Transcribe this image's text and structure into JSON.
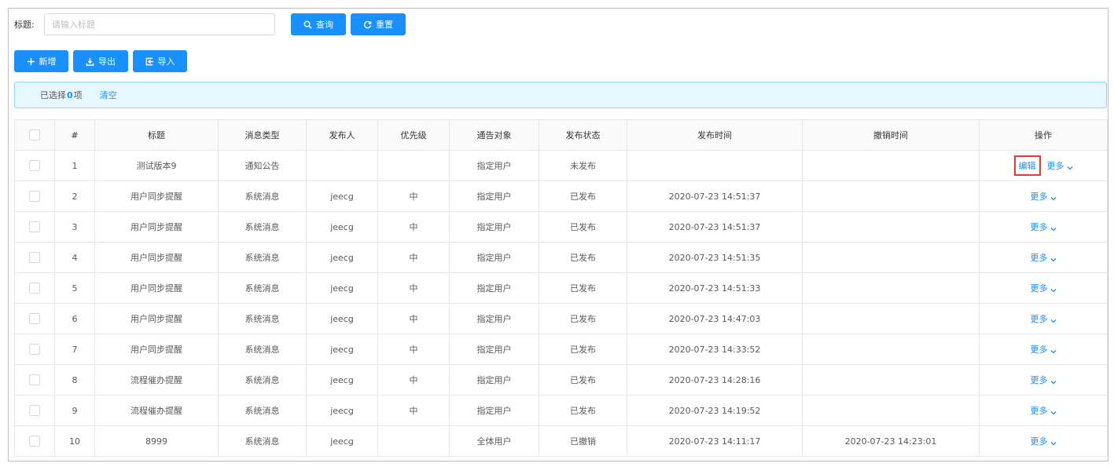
{
  "search": {
    "label": "标题:",
    "placeholder": "请输入标题",
    "query_label": "查询",
    "reset_label": "重置"
  },
  "toolbar": {
    "add_label": "新增",
    "export_label": "导出",
    "import_label": "导入"
  },
  "alert": {
    "prefix": "已选择",
    "count": "0",
    "suffix": "项",
    "clear_label": "清空"
  },
  "table": {
    "columns": [
      "#",
      "标题",
      "消息类型",
      "发布人",
      "优先级",
      "通告对象",
      "发布状态",
      "发布时间",
      "撤销时间",
      "操作"
    ],
    "edit_label": "编辑",
    "more_label": "更多",
    "rows": [
      {
        "index": "1",
        "title": "测试版本9",
        "type": "通知公告",
        "publisher": "",
        "priority": "",
        "target": "指定用户",
        "status": "未发布",
        "publish_time": "",
        "revoke_time": "",
        "has_edit": true
      },
      {
        "index": "2",
        "title": "用户同步提醒",
        "type": "系统消息",
        "publisher": "jeecg",
        "priority": "中",
        "target": "指定用户",
        "status": "已发布",
        "publish_time": "2020-07-23 14:51:37",
        "revoke_time": "",
        "has_edit": false
      },
      {
        "index": "3",
        "title": "用户同步提醒",
        "type": "系统消息",
        "publisher": "jeecg",
        "priority": "中",
        "target": "指定用户",
        "status": "已发布",
        "publish_time": "2020-07-23 14:51:37",
        "revoke_time": "",
        "has_edit": false
      },
      {
        "index": "4",
        "title": "用户同步提醒",
        "type": "系统消息",
        "publisher": "jeecg",
        "priority": "中",
        "target": "指定用户",
        "status": "已发布",
        "publish_time": "2020-07-23 14:51:35",
        "revoke_time": "",
        "has_edit": false
      },
      {
        "index": "5",
        "title": "用户同步提醒",
        "type": "系统消息",
        "publisher": "jeecg",
        "priority": "中",
        "target": "指定用户",
        "status": "已发布",
        "publish_time": "2020-07-23 14:51:33",
        "revoke_time": "",
        "has_edit": false
      },
      {
        "index": "6",
        "title": "用户同步提醒",
        "type": "系统消息",
        "publisher": "jeecg",
        "priority": "中",
        "target": "指定用户",
        "status": "已发布",
        "publish_time": "2020-07-23 14:47:03",
        "revoke_time": "",
        "has_edit": false
      },
      {
        "index": "7",
        "title": "用户同步提醒",
        "type": "系统消息",
        "publisher": "jeecg",
        "priority": "中",
        "target": "指定用户",
        "status": "已发布",
        "publish_time": "2020-07-23 14:33:52",
        "revoke_time": "",
        "has_edit": false
      },
      {
        "index": "8",
        "title": "流程催办提醒",
        "type": "系统消息",
        "publisher": "jeecg",
        "priority": "中",
        "target": "指定用户",
        "status": "已发布",
        "publish_time": "2020-07-23 14:28:16",
        "revoke_time": "",
        "has_edit": false
      },
      {
        "index": "9",
        "title": "流程催办提醒",
        "type": "系统消息",
        "publisher": "jeecg",
        "priority": "中",
        "target": "指定用户",
        "status": "已发布",
        "publish_time": "2020-07-23 14:19:52",
        "revoke_time": "",
        "has_edit": false
      },
      {
        "index": "10",
        "title": "8999",
        "type": "系统消息",
        "publisher": "jeecg",
        "priority": "",
        "target": "全体用户",
        "status": "已撤销",
        "publish_time": "2020-07-23 14:11:17",
        "revoke_time": "2020-07-23 14:23:01",
        "has_edit": false
      }
    ]
  }
}
